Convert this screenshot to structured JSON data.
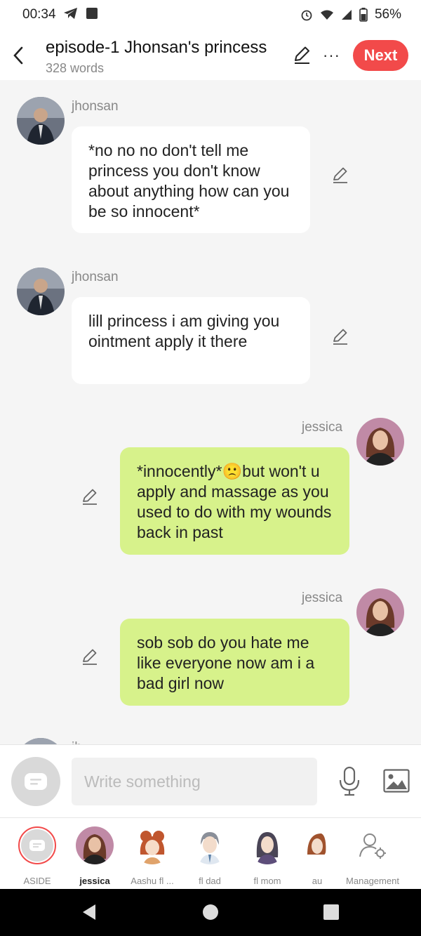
{
  "status_bar": {
    "time": "00:34",
    "battery": "56%"
  },
  "header": {
    "title": "episode-1 Jhonsan's princess",
    "word_count": "328 words",
    "next_label": "Next"
  },
  "messages": [
    {
      "sender": "jhonsan",
      "side": "left",
      "text": "*no no no don't tell me princess you don't know about anything how can you be so innocent*"
    },
    {
      "sender": "jhonsan",
      "side": "left",
      "text": "lill princess i am giving you ointment apply it there"
    },
    {
      "sender": "jessica",
      "side": "right",
      "text_before": "*innocently*",
      "emoji": "🙁",
      "text_after": "but won't u apply and massage as you used to do with my wounds back in past"
    },
    {
      "sender": "jessica",
      "side": "right",
      "text": "sob sob do you hate me like everyone now am i a bad girl  now"
    },
    {
      "sender": "jh",
      "side": "left",
      "text": ""
    }
  ],
  "composer": {
    "placeholder": "Write something"
  },
  "characters": [
    {
      "label": "ASIDE"
    },
    {
      "label": "jessica"
    },
    {
      "label": "Aashu fl ..."
    },
    {
      "label": "fl dad"
    },
    {
      "label": "fl mom"
    },
    {
      "label": "au"
    },
    {
      "label": "Management"
    }
  ],
  "colors": {
    "accent": "#f24a4a",
    "green_bubble": "#d7f28b",
    "background": "#f5f5f5"
  }
}
